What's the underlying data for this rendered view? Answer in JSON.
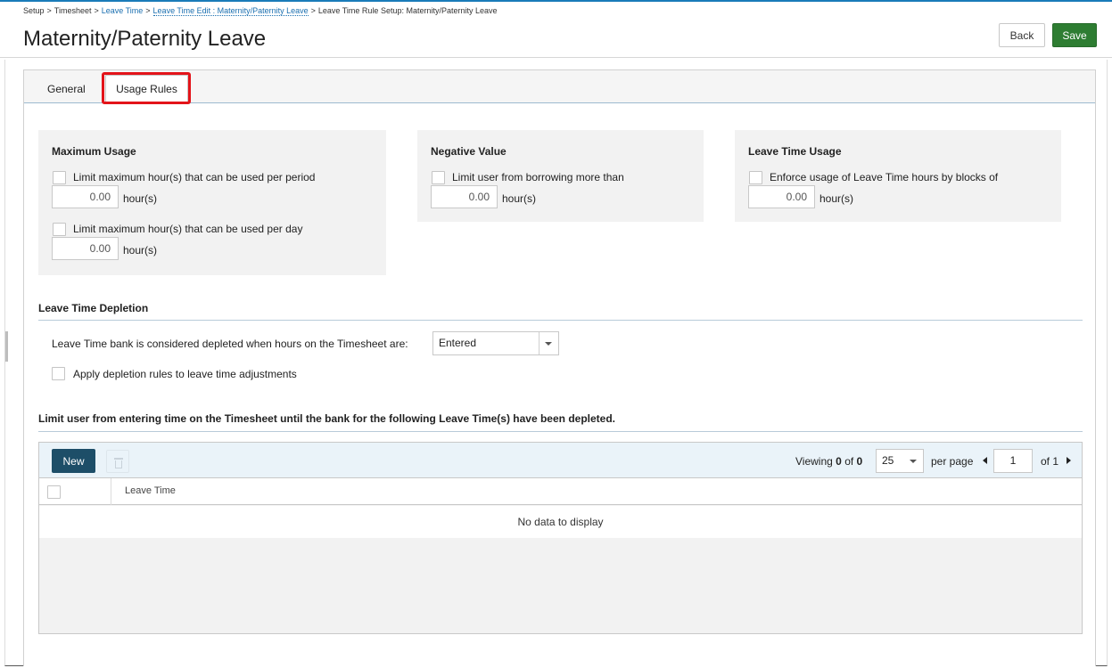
{
  "breadcrumb": {
    "items": [
      {
        "label": "Setup",
        "link": false
      },
      {
        "label": "Timesheet",
        "link": false
      },
      {
        "label": "Leave Time",
        "link": true
      },
      {
        "label": "Leave Time Edit : Maternity/Paternity Leave",
        "link": true
      },
      {
        "label": "Leave Time Rule Setup: Maternity/Paternity Leave",
        "link": false
      }
    ],
    "separator": ">"
  },
  "header": {
    "title": "Maternity/Paternity Leave",
    "back_label": "Back",
    "save_label": "Save",
    "save_color": "#2e7d32"
  },
  "tabs": [
    {
      "label": "General",
      "active": false
    },
    {
      "label": "Usage Rules",
      "active": true
    }
  ],
  "highlight_color": "#e3141a",
  "maximum_usage": {
    "title": "Maximum Usage",
    "per_period": {
      "label": "Limit maximum hour(s) that can be used per period",
      "value": "0.00",
      "unit": "hour(s)",
      "checked": false
    },
    "per_day": {
      "label": "Limit maximum hour(s) that can be used per day",
      "value": "0.00",
      "unit": "hour(s)",
      "checked": false
    }
  },
  "negative_value": {
    "title": "Negative Value",
    "borrow": {
      "label": "Limit user from borrowing more than",
      "value": "0.00",
      "unit": "hour(s)",
      "checked": false
    }
  },
  "leave_time_usage": {
    "title": "Leave Time Usage",
    "blocks": {
      "label": "Enforce usage of Leave Time hours by blocks of",
      "value": "0.00",
      "unit": "hour(s)",
      "checked": false
    }
  },
  "depletion": {
    "title": "Leave Time Depletion",
    "question": "Leave Time bank is considered depleted when hours on the Timesheet are:",
    "selected": "Entered",
    "adjustments_label": "Apply depletion rules to leave time adjustments",
    "adjustments_checked": false
  },
  "limit_section": {
    "title": "Limit user from entering time on the Timesheet until the bank for the following Leave Time(s) have been depleted."
  },
  "grid": {
    "new_label": "New",
    "viewing_prefix": "Viewing",
    "viewing_from": "0",
    "viewing_of": "of",
    "viewing_total": "0",
    "page_size": "25",
    "per_page_label": "per page",
    "page": "1",
    "page_of": "of 1",
    "column_leave_time": "Leave Time",
    "empty_message": "No data to display",
    "new_button_color": "#1d4e68"
  }
}
